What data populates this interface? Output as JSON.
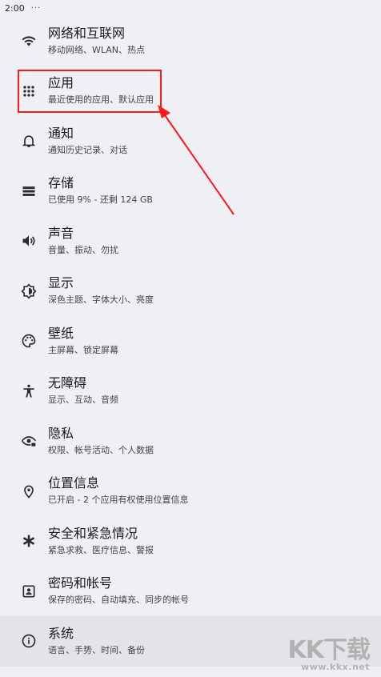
{
  "status_bar": {
    "time": "2:00",
    "more": "···"
  },
  "settings": [
    {
      "title": "网络和互联网",
      "subtitle": "移动网络、WLAN、热点",
      "icon": "wifi-icon"
    },
    {
      "title": "应用",
      "subtitle": "最近使用的应用、默认应用",
      "icon": "apps-grid-icon"
    },
    {
      "title": "通知",
      "subtitle": "通知历史记录、对话",
      "icon": "bell-icon"
    },
    {
      "title": "存储",
      "subtitle": "已使用 9% - 还剩 124 GB",
      "icon": "storage-icon"
    },
    {
      "title": "声音",
      "subtitle": "音量、振动、勿扰",
      "icon": "volume-icon"
    },
    {
      "title": "显示",
      "subtitle": "深色主题、字体大小、亮度",
      "icon": "brightness-icon"
    },
    {
      "title": "壁纸",
      "subtitle": "主屏幕、锁定屏幕",
      "icon": "palette-icon"
    },
    {
      "title": "无障碍",
      "subtitle": "显示、互动、音频",
      "icon": "accessibility-icon"
    },
    {
      "title": "隐私",
      "subtitle": "权限、帐号活动、个人数据",
      "icon": "privacy-eye-icon"
    },
    {
      "title": "位置信息",
      "subtitle": "已开启 - 2 个应用有权使用位置信息",
      "icon": "location-pin-icon"
    },
    {
      "title": "安全和紧急情况",
      "subtitle": "紧急求救、医疗信息、警报",
      "icon": "emergency-asterisk-icon"
    },
    {
      "title": "密码和帐号",
      "subtitle": "保存的密码、自动填充、同步的帐号",
      "icon": "account-box-icon"
    },
    {
      "title": "系统",
      "subtitle": "语言、手势、时间、备份",
      "icon": "info-icon"
    }
  ],
  "annotation": {
    "color": "#ff1a1a"
  },
  "watermark": {
    "logo": "KK下载",
    "url": "www.kkx.net"
  }
}
